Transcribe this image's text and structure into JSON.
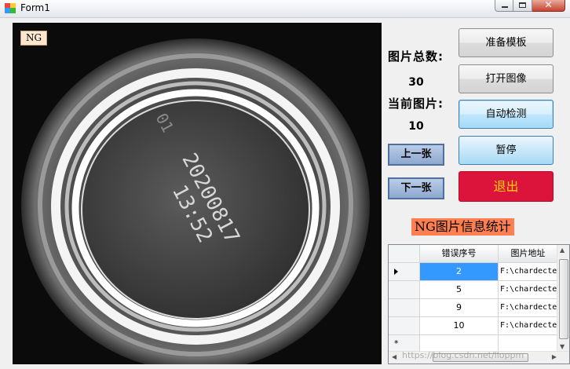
{
  "window": {
    "title": "Form1",
    "close_glyph": "✕"
  },
  "viewer": {
    "badge": "NG",
    "engraving": {
      "line1": "20200817",
      "line2": "13:52",
      "code": "01"
    }
  },
  "counts": {
    "total_label": "图片总数:",
    "total_value": "30",
    "current_label": "当前图片:",
    "current_value": "10"
  },
  "nav": {
    "prev_label": "上一张",
    "next_label": "下一张"
  },
  "actions": {
    "prepare_template": "准备模板",
    "open_image": "打开图像",
    "auto_detect": "自动检测",
    "pause": "暂停",
    "exit": "退出"
  },
  "stats_title": "NG图片信息统计",
  "grid": {
    "columns": [
      "错误序号",
      "图片地址"
    ],
    "rows": [
      {
        "index": "2",
        "path": "F:\\chardecte"
      },
      {
        "index": "5",
        "path": "F:\\chardecte"
      },
      {
        "index": "9",
        "path": "F:\\chardecte"
      },
      {
        "index": "10",
        "path": "F:\\chardecte"
      }
    ],
    "new_row_marker": "*"
  },
  "watermark": "https://blog.csdn.net/lloppm",
  "colors": {
    "exit_bg": "#dc143c",
    "exit_text": "#ffd700",
    "stats_title_bg": "#ff7f50",
    "selected_cell": "#3399ff"
  }
}
